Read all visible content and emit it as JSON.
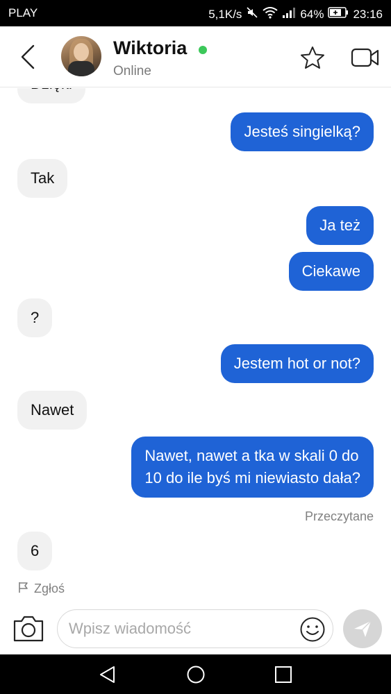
{
  "statusbar": {
    "carrier": "PLAY",
    "speed": "5,1K/s",
    "battery": "64%",
    "time": "23:16",
    "icons": [
      "mute-icon",
      "wifi-icon",
      "signal-icon",
      "battery-icon"
    ]
  },
  "header": {
    "name": "Wiktoria",
    "status": "Online",
    "online_color": "#3cc85a",
    "icons": [
      "back-icon",
      "avatar",
      "star-icon",
      "video-call-icon"
    ]
  },
  "messages": [
    {
      "side": "in",
      "text": "Dzięki"
    },
    {
      "side": "out",
      "text": "Jesteś singielką?"
    },
    {
      "side": "in",
      "text": "Tak"
    },
    {
      "side": "out",
      "text": "Ja też"
    },
    {
      "side": "out",
      "text": "Ciekawe"
    },
    {
      "side": "in",
      "text": "?"
    },
    {
      "side": "out",
      "text": "Jestem hot or not?"
    },
    {
      "side": "in",
      "text": "Nawet"
    },
    {
      "side": "out",
      "text_line1": "Nawet, nawet a tka w skali 0 do",
      "text_line2": "10 do ile byś mi niewiasto dała?"
    },
    {
      "side": "in",
      "text": "6"
    }
  ],
  "read_receipt": "Przeczytane",
  "report_label": "Zgłoś",
  "composer": {
    "placeholder": "Wpisz wiadomość",
    "icons": [
      "camera-icon",
      "emoji-icon",
      "send-icon"
    ]
  },
  "colors": {
    "outgoing_bubble": "#1f63d6",
    "incoming_bubble": "#f1f1f1",
    "send_button": "#d6d6d6"
  },
  "navbar": {
    "icons": [
      "nav-back-icon",
      "nav-home-icon",
      "nav-recents-icon"
    ]
  }
}
